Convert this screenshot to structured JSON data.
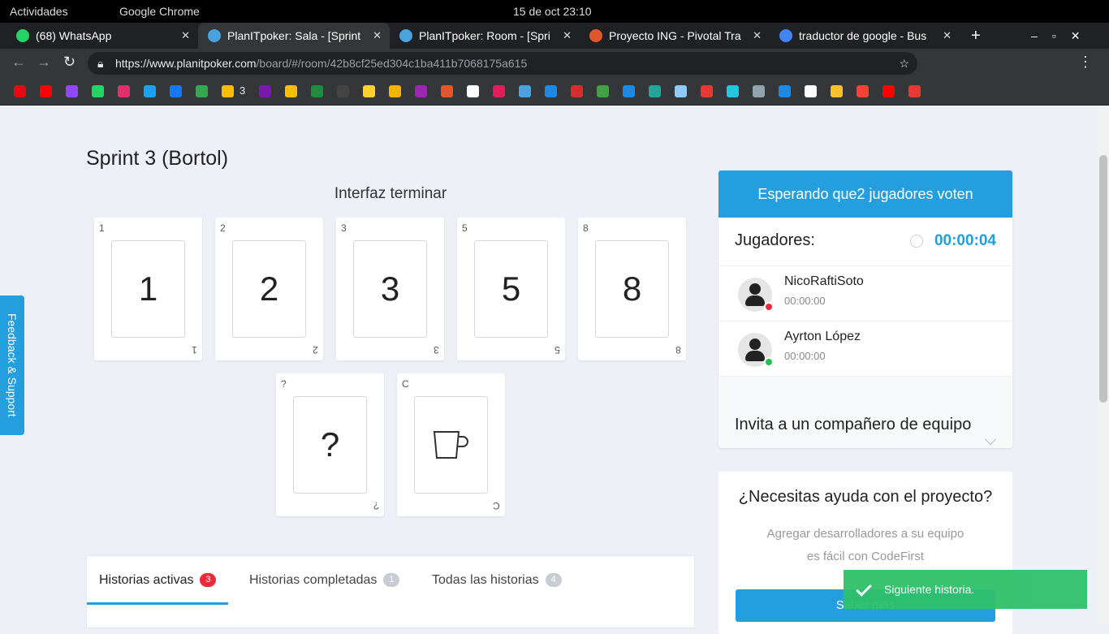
{
  "os": {
    "activities": "Actividades",
    "app": "Google Chrome",
    "datetime": "15 de oct  23:10"
  },
  "browser": {
    "tabs": [
      {
        "title": "(68) WhatsApp",
        "color": "#25d366"
      },
      {
        "title": "PlanITpoker: Sala - [Sprint",
        "color": "#4aa3df"
      },
      {
        "title": "PlanITpoker: Room - [Spri",
        "color": "#4aa3df"
      },
      {
        "title": "Proyecto ING - Pivotal Tra",
        "color": "#e0582a"
      },
      {
        "title": "traductor de google - Bus",
        "color": "#4285f4"
      }
    ],
    "new_tab": "+",
    "url_host": "https://www.planitpoker.com",
    "url_path": "/board/#/room/42b8cf25ed304c1ba411b7068175a615",
    "bookmarks": [
      {
        "icon": "netflix-icon",
        "color": "#e50914"
      },
      {
        "icon": "youtube-icon",
        "color": "#ff0000"
      },
      {
        "icon": "twitch-icon",
        "color": "#9146ff"
      },
      {
        "icon": "whatsapp-icon",
        "color": "#25d366"
      },
      {
        "icon": "instagram-icon",
        "color": "#e1306c"
      },
      {
        "icon": "twitter-icon",
        "color": "#1da1f2"
      },
      {
        "icon": "facebook-icon",
        "color": "#1877f2"
      },
      {
        "icon": "drive-icon",
        "color": "#34a853"
      },
      {
        "icon": "drive-icon",
        "color": "#fbbc04",
        "label": "3"
      },
      {
        "icon": "onenote-icon",
        "color": "#7719aa"
      },
      {
        "icon": "keep-icon",
        "color": "#fbbc04"
      },
      {
        "icon": "classroom-icon",
        "color": "#1e8e3e"
      },
      {
        "icon": "github-icon",
        "color": "#444"
      },
      {
        "icon": "miro-icon",
        "color": "#ffd02f"
      },
      {
        "icon": "app-icon",
        "color": "#f4b400"
      },
      {
        "icon": "palette-icon",
        "color": "#9c27b0"
      },
      {
        "icon": "pivotal-icon",
        "color": "#e0582a"
      },
      {
        "icon": "trello-icon",
        "color": "#fff"
      },
      {
        "icon": "slack-icon",
        "color": "#e01e5a"
      },
      {
        "icon": "app-icon",
        "color": "#4aa3df"
      },
      {
        "icon": "app-icon",
        "color": "#1e88e5"
      },
      {
        "icon": "app-icon",
        "color": "#d32f2f"
      },
      {
        "icon": "app-icon",
        "color": "#43a047"
      },
      {
        "icon": "app-icon",
        "color": "#1e88e5"
      },
      {
        "icon": "app-icon",
        "color": "#26a69a"
      },
      {
        "icon": "app-icon",
        "color": "#90caf9"
      },
      {
        "icon": "app-icon",
        "color": "#e53935"
      },
      {
        "icon": "app-icon",
        "color": "#26c6da"
      },
      {
        "icon": "app-icon",
        "color": "#90a4ae"
      },
      {
        "icon": "app-icon",
        "color": "#1e88e5"
      },
      {
        "icon": "app-icon",
        "color": "#fff"
      },
      {
        "icon": "app-icon",
        "color": "#fbc02d"
      },
      {
        "icon": "app-icon",
        "color": "#f44336"
      },
      {
        "icon": "youtube-icon",
        "color": "#ff0000"
      },
      {
        "icon": "app-icon",
        "color": "#e53935"
      }
    ]
  },
  "room": {
    "title": "Sprint 3 (Bortol)",
    "story": "Interfaz terminar",
    "cards": [
      {
        "corner": "1",
        "value": "1"
      },
      {
        "corner": "2",
        "value": "2"
      },
      {
        "corner": "3",
        "value": "3"
      },
      {
        "corner": "5",
        "value": "5"
      },
      {
        "corner": "8",
        "value": "8"
      },
      {
        "corner": "?",
        "value": "?"
      },
      {
        "corner": "C",
        "value": "coffee"
      }
    ],
    "feedback": "Feedback & Support",
    "story_tabs": [
      {
        "label": "Historias activas",
        "count": "3"
      },
      {
        "label": "Historias completadas",
        "count": "1"
      },
      {
        "label": "Todas las historias",
        "count": "4"
      }
    ]
  },
  "panel": {
    "header": "Esperando que2 jugadores voten",
    "players_label": "Jugadores:",
    "timer": "00:00:04",
    "players": [
      {
        "name": "NicoRaftiSoto",
        "time": "00:00:00",
        "status_color": "#f0283c"
      },
      {
        "name": "Ayrton López",
        "time": "00:00:00",
        "status_color": "#1dc44f"
      }
    ],
    "invite": "Invita a un compañero de equipo"
  },
  "help": {
    "title": "¿Necesitas ayuda con el proyecto?",
    "line1": "Agregar desarrolladores a su equipo",
    "line2": "es fácil con CodeFirst",
    "button": "Saber más"
  },
  "toast": "Siguiente historia."
}
